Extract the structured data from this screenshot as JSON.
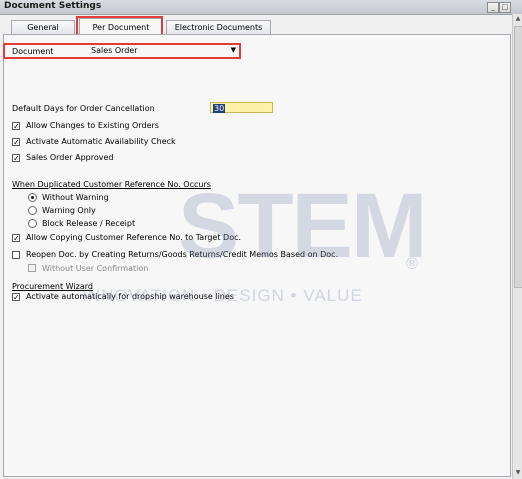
{
  "window": {
    "title": "Document Settings"
  },
  "tabs": [
    {
      "label": "General"
    },
    {
      "label": "Per Document"
    },
    {
      "label": "Electronic Documents"
    }
  ],
  "document": {
    "label": "Document",
    "value": "Sales Order"
  },
  "cancellation": {
    "label": "Default Days for Order Cancellation",
    "value": "30"
  },
  "options": [
    {
      "label": "Allow Changes to Existing Orders",
      "checked": true
    },
    {
      "label": "Activate Automatic Availability Check",
      "checked": true
    },
    {
      "label": "Sales Order Approved",
      "checked": true
    }
  ],
  "duplicate": {
    "heading": "When Duplicated Customer Reference No. Occurs",
    "radios": [
      {
        "label": "Without Warning",
        "selected": true
      },
      {
        "label": "Warning Only",
        "selected": false
      },
      {
        "label": "Block Release / Receipt",
        "selected": false
      }
    ]
  },
  "copy_ref": {
    "label": "Allow Copying Customer Reference No. to Target Doc.",
    "checked": true
  },
  "reopen": {
    "label": "Reopen Doc. by Creating Returns/Goods Returns/Credit Memos Based on Doc.",
    "checked": false
  },
  "without_confirmation": {
    "label": "Without User Confirmation",
    "checked": false
  },
  "procurement": {
    "heading": "Procurement Wizard",
    "option": {
      "label": "Activate automatically for dropship warehouse lines",
      "checked": true
    }
  },
  "watermark": {
    "brand": "STEM",
    "tagline": "INNOVATION • DESIGN • VALUE"
  }
}
